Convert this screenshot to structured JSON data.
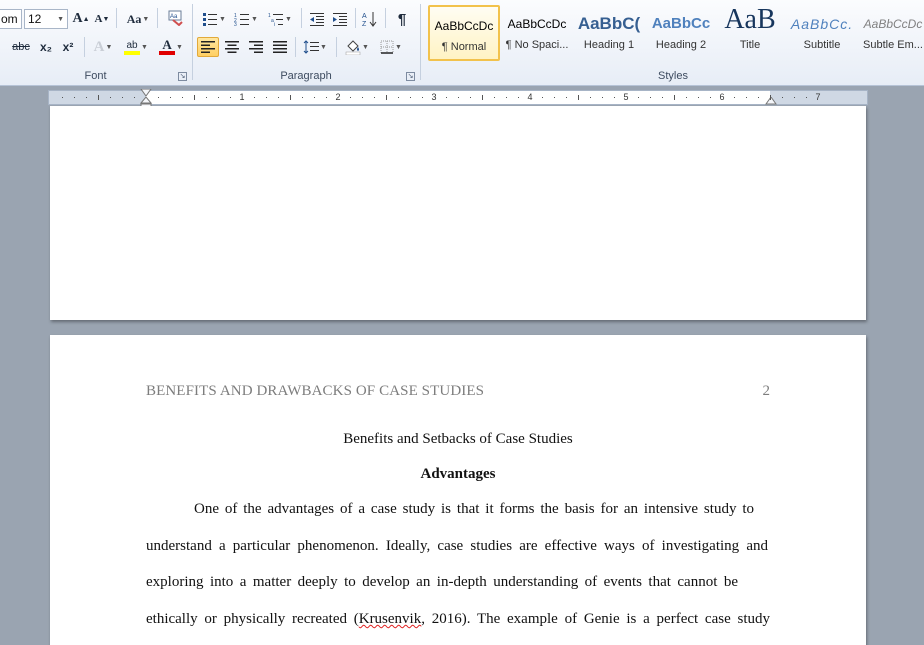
{
  "ribbon": {
    "font_group": {
      "label": "Font",
      "font_name": "om",
      "font_size": "12",
      "grow_label": "A",
      "shrink_label": "A",
      "change_case_label": "Aa",
      "strike_label": "abc",
      "subscript_label": "x₂",
      "superscript_label": "x²",
      "text_effects_label": "A",
      "highlight_label": "ab",
      "font_color_label": "A"
    },
    "paragraph_group": {
      "label": "Paragraph",
      "show_marks_label": "¶"
    },
    "styles_group": {
      "label": "Styles",
      "items": [
        {
          "sample": "AaBbCcDc",
          "name": "¶ Normal"
        },
        {
          "sample": "AaBbCcDc",
          "name": "¶ No Spaci..."
        },
        {
          "sample": "AaBbC(",
          "name": "Heading 1"
        },
        {
          "sample": "AaBbCc",
          "name": "Heading 2"
        },
        {
          "sample": "AaB",
          "name": "Title"
        },
        {
          "sample": "AaBbCc.",
          "name": "Subtitle"
        },
        {
          "sample": "AaBbCcDc",
          "name": "Subtle Em..."
        }
      ]
    },
    "colors": {
      "highlight": "#ffff00",
      "font_color": "#e00000",
      "heading": "#365f91"
    }
  },
  "ruler": {
    "numbers": [
      "1",
      "2",
      "3",
      "4",
      "5",
      "6",
      "7"
    ]
  },
  "document": {
    "header_title": "BENEFITS AND DRAWBACKS OF CASE STUDIES",
    "page_number": "2",
    "title": "Benefits and Setbacks of Case Studies",
    "heading": "Advantages",
    "lines": [
      "One of the advantages of a case study is that it forms the basis for an intensive study to",
      "understand a particular phenomenon. Ideally, case studies are effective ways of investigating and",
      "exploring into a matter deeply to develop an in-depth understanding of events that cannot be"
    ],
    "line4_before": "ethically or physically recreated (",
    "line4_citation": "Krusenvik",
    "line4_after": ", 2016). The example of Genie is a perfect case study"
  }
}
